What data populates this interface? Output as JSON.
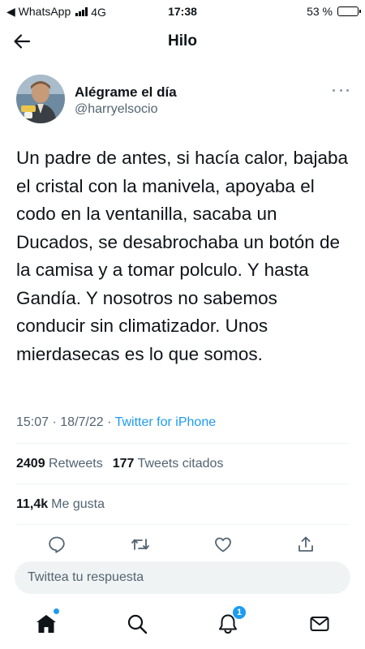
{
  "status_bar": {
    "back_app": "◀ WhatsApp",
    "network": "4G",
    "time": "17:38",
    "battery_text": "53 %",
    "battery_level": 0.53
  },
  "header": {
    "title": "Hilo"
  },
  "author": {
    "name": "Alégrame el día",
    "handle": "@harryelsocio"
  },
  "tweet": {
    "text": "Un padre de antes, si hacía calor, bajaba el cristal con la manivela, apoyaba el codo en la ventanilla, sacaba un Ducados, se desabrochaba un botón de la camisa y a tomar polculo. Y hasta Gandía. Y nosotros no sabemos conducir sin climatizador. Unos mierdasecas es lo que somos.",
    "time": "15:07",
    "date": "18/7/22",
    "separator": "·",
    "source": "Twitter for iPhone"
  },
  "stats": {
    "retweets_count": "2409",
    "retweets_label": "Retweets",
    "quotes_count": "177",
    "quotes_label": "Tweets citados",
    "likes_count": "11,4k",
    "likes_label": "Me gusta"
  },
  "actions": [
    "reply-icon",
    "retweet-icon",
    "like-icon",
    "share-icon"
  ],
  "reply": {
    "placeholder": "Twittea tu respuesta"
  },
  "nav": {
    "items": [
      "home-icon",
      "search-icon",
      "notifications-icon",
      "messages-icon"
    ],
    "notifications_badge": "1"
  },
  "colors": {
    "accent": "#1d9bf0",
    "text": "#0f1419",
    "secondary": "#536471"
  }
}
